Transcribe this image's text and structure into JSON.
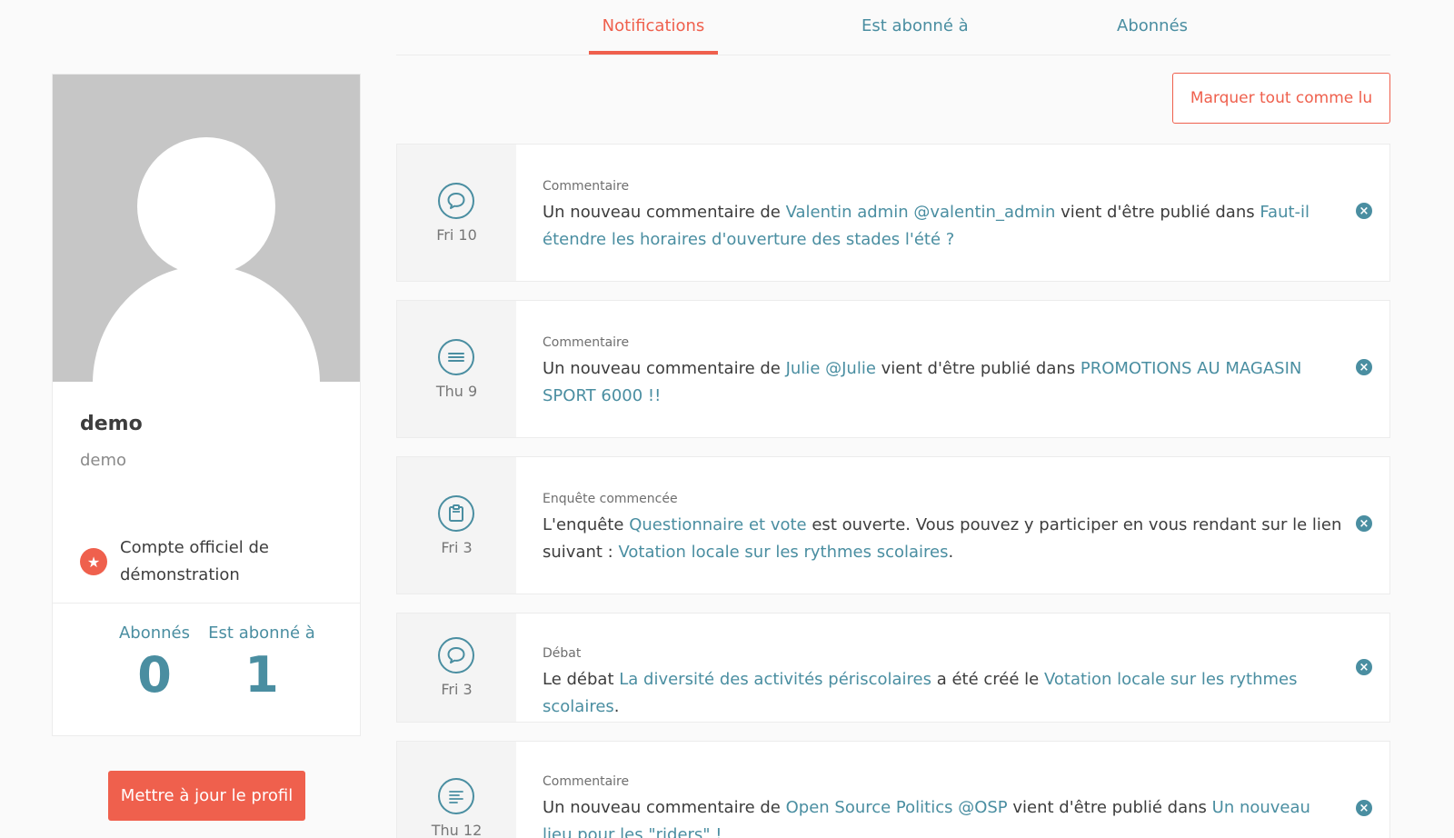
{
  "tabs": [
    {
      "label": "Notifications",
      "active": true
    },
    {
      "label": "Est abonné à",
      "active": false
    },
    {
      "label": "Abonnés",
      "active": false
    }
  ],
  "mark_all_read_label": "Marquer tout comme lu",
  "profile": {
    "name": "demo",
    "nickname": "demo",
    "official_badge_text": "Compte officiel de démonstration",
    "followers_label": "Abonnés",
    "followers_count": "0",
    "following_label": "Est abonné à",
    "following_count": "1",
    "update_button_label": "Mettre à jour le profil"
  },
  "notifications": [
    {
      "icon": "comment-bubble-icon",
      "date": "Fri 10",
      "type": "Commentaire",
      "parts": [
        {
          "t": "Un nouveau commentaire de "
        },
        {
          "t": "Valentin admin @valentin_admin",
          "link": true
        },
        {
          "t": " vient d'être publié dans "
        },
        {
          "t": "Faut-il étendre les horaires d'ouverture des stades l'été ?",
          "link": true
        }
      ]
    },
    {
      "icon": "proposal-lines-icon",
      "date": "Thu 9",
      "type": "Commentaire",
      "parts": [
        {
          "t": "Un nouveau commentaire de "
        },
        {
          "t": "Julie @Julie",
          "link": true
        },
        {
          "t": " vient d'être publié dans "
        },
        {
          "t": "PROMOTIONS AU MAGASIN SPORT 6000 !!",
          "link": true
        }
      ]
    },
    {
      "icon": "clipboard-icon",
      "date": "Fri 3",
      "type": "Enquête commencée",
      "parts": [
        {
          "t": "L'enquête "
        },
        {
          "t": "Questionnaire et vote",
          "link": true
        },
        {
          "t": " est ouverte. Vous pouvez y participer en vous rendant sur le lien suivant : "
        },
        {
          "t": "Votation locale sur les rythmes scolaires",
          "link": true
        },
        {
          "t": "."
        }
      ]
    },
    {
      "icon": "comment-bubble-icon",
      "date": "Fri 3",
      "type": "Débat",
      "parts": [
        {
          "t": "Le débat "
        },
        {
          "t": "La diversité des activités périscolaires",
          "link": true
        },
        {
          "t": " a été créé le "
        },
        {
          "t": "Votation locale sur les rythmes scolaires",
          "link": true
        },
        {
          "t": "."
        }
      ]
    },
    {
      "icon": "text-lines-icon",
      "date": "Thu 12",
      "type": "Commentaire",
      "parts": [
        {
          "t": "Un nouveau commentaire de "
        },
        {
          "t": "Open Source Politics @OSP",
          "link": true
        },
        {
          "t": " vient d'être publié dans "
        },
        {
          "t": "Un nouveau lieu pour les \"riders\" !",
          "link": true
        }
      ]
    }
  ],
  "colors": {
    "accent": "#ef604d",
    "link": "#4a8ea1"
  }
}
